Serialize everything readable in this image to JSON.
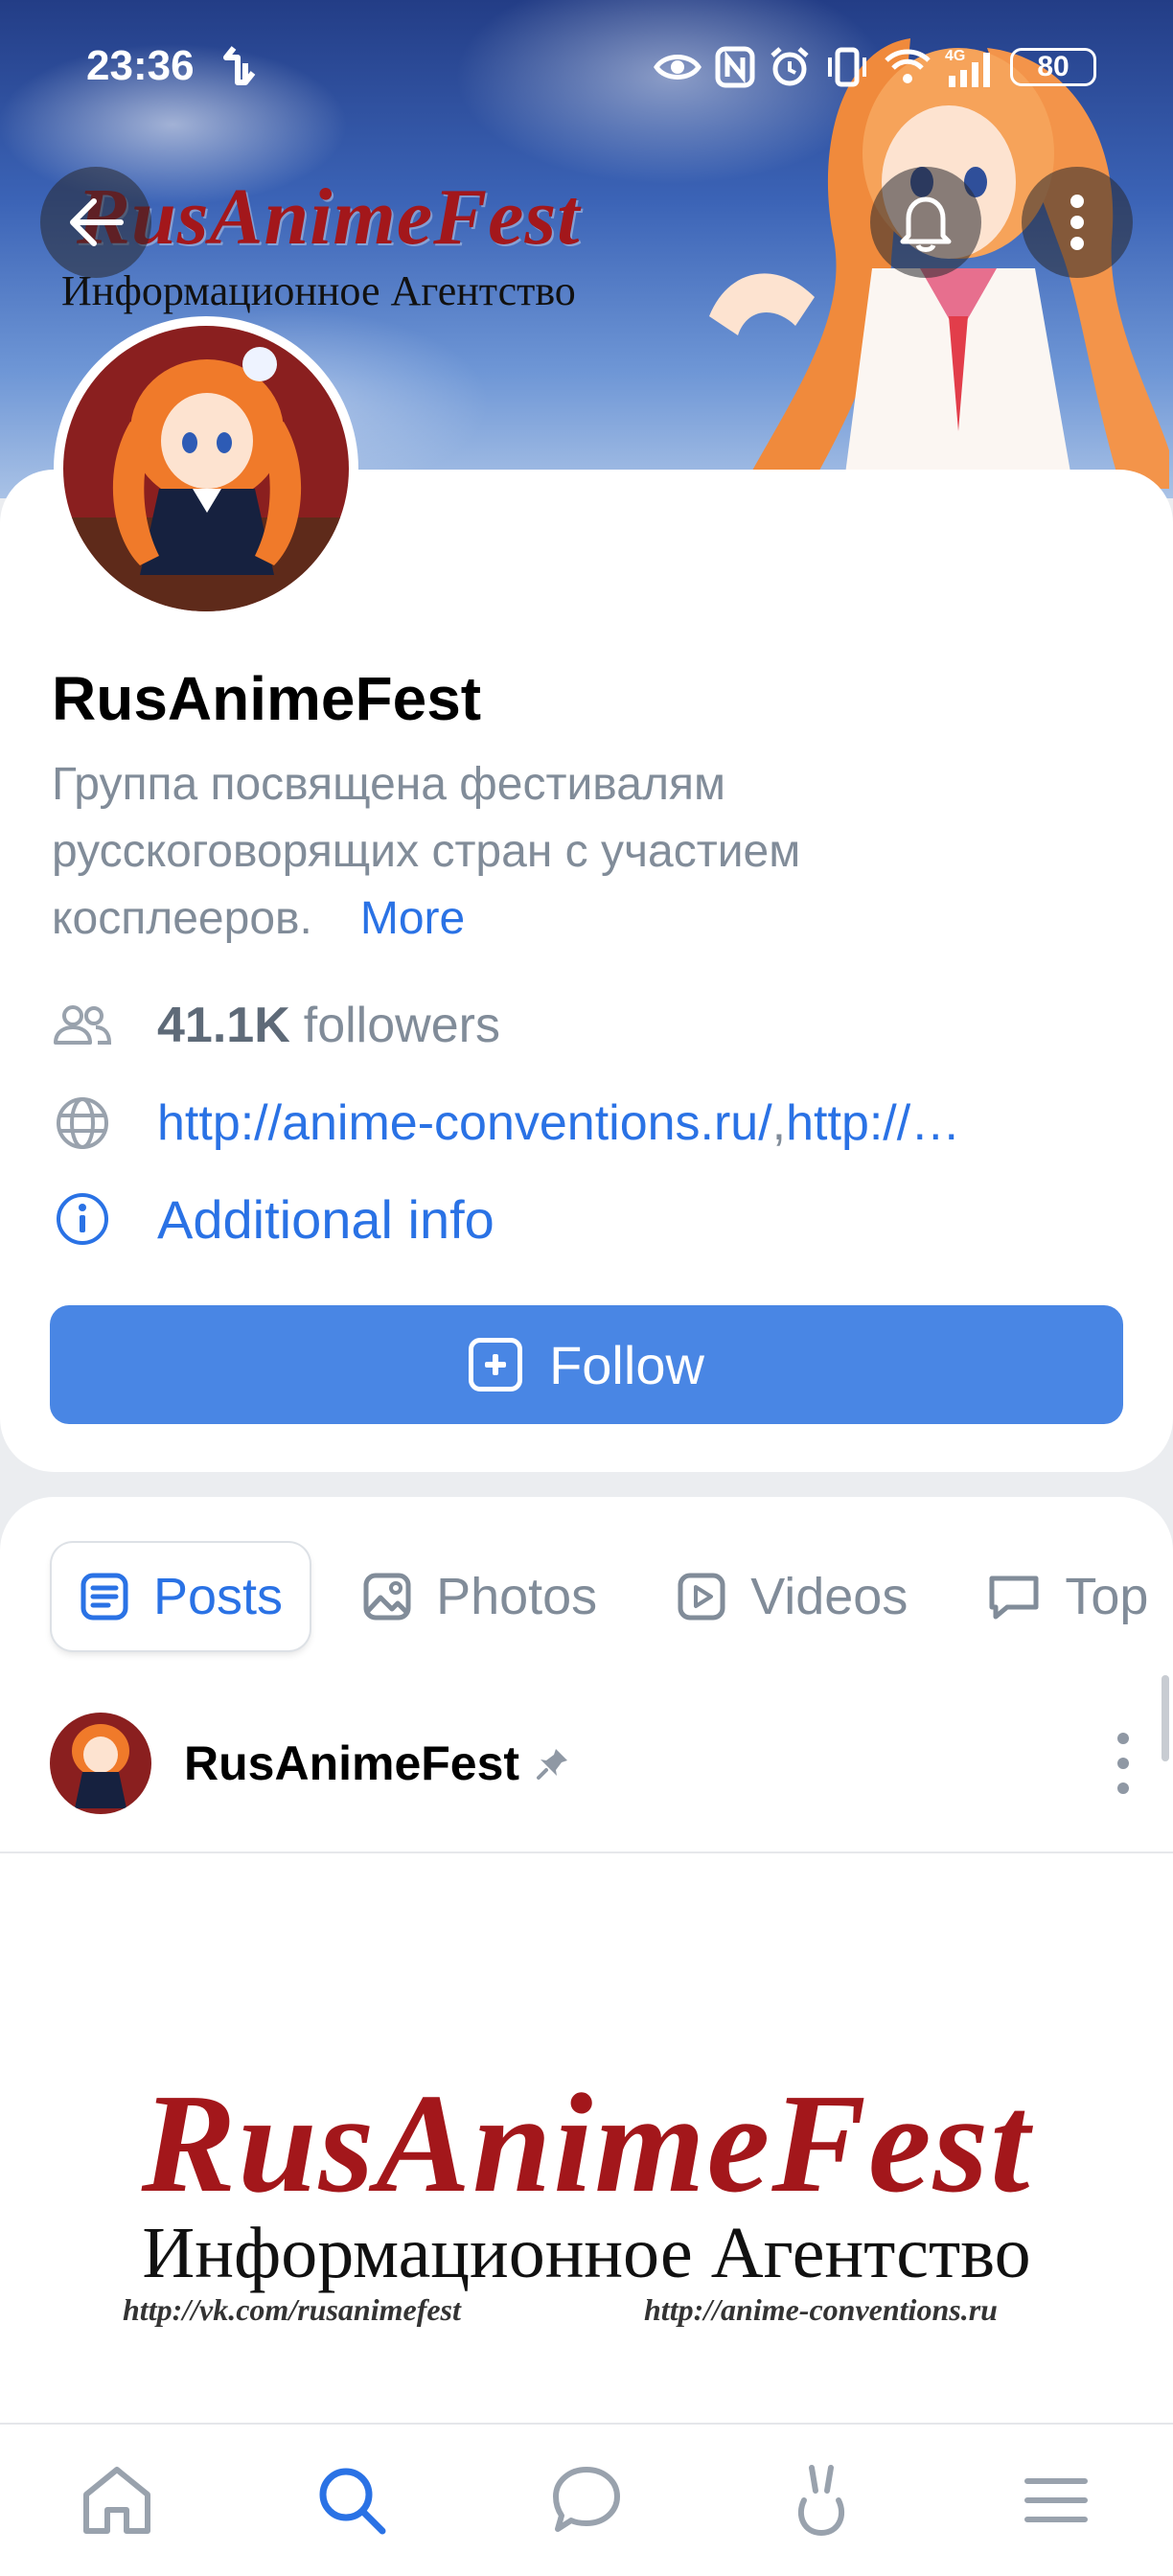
{
  "status_bar": {
    "time": "23:36",
    "battery": "80",
    "network": "4G"
  },
  "cover": {
    "logo_title": "RusAnimeFest",
    "logo_subtitle": "Информационное Агентство"
  },
  "profile": {
    "name": "RusAnimeFest",
    "description": "Группа посвящена фестивалям русскоговорящих стран с участием косплееров.",
    "more_label": "More",
    "followers_count": "41.1K",
    "followers_label": "followers",
    "link_primary": "http://anime-conventions.ru/",
    "link_separator": ", ",
    "link_secondary": "http://…",
    "additional_info_label": "Additional info",
    "follow_label": "Follow"
  },
  "tabs": [
    {
      "label": "Posts",
      "icon": "posts-icon",
      "active": true
    },
    {
      "label": "Photos",
      "icon": "photo-icon",
      "active": false
    },
    {
      "label": "Videos",
      "icon": "video-icon",
      "active": false
    },
    {
      "label": "Top",
      "icon": "topics-icon",
      "active": false
    }
  ],
  "post": {
    "author": "RusAnimeFest",
    "pinned": true,
    "image_title": "RusAnimeFest",
    "image_subtitle": "Информационное Агентство",
    "image_url_left": "http://vk.com/rusanimefest",
    "image_url_right": "http://anime-conventions.ru"
  },
  "bottom_nav": [
    "home-icon",
    "search-icon",
    "messages-icon",
    "clips-icon",
    "menu-icon"
  ],
  "colors": {
    "accent": "#2a72e5",
    "follow_button": "#4986e4",
    "secondary_text": "#818c99",
    "logo_red": "#a3171b"
  }
}
